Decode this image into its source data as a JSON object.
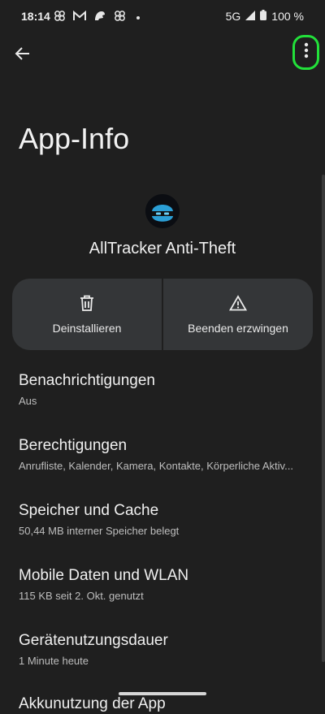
{
  "status": {
    "time": "18:14",
    "network": "5G",
    "battery": "100 %",
    "left_icons": [
      "pinwheel-icon",
      "gmail-icon",
      "dino-icon",
      "pinwheel-icon"
    ]
  },
  "page": {
    "title": "App-Info"
  },
  "app": {
    "name": "AllTracker Anti-Theft",
    "icon": "ninja-mask-icon"
  },
  "actions": [
    {
      "label": "Deinstallieren",
      "icon": "trash-icon"
    },
    {
      "label": "Beenden erzwingen",
      "icon": "warning-icon"
    }
  ],
  "settings": [
    {
      "title": "Benachrichtigungen",
      "subtitle": "Aus"
    },
    {
      "title": "Berechtigungen",
      "subtitle": "Anrufliste, Kalender, Kamera, Kontakte, Körperliche Aktiv..."
    },
    {
      "title": "Speicher und Cache",
      "subtitle": "50,44 MB interner Speicher belegt"
    },
    {
      "title": "Mobile Daten und WLAN",
      "subtitle": "115 KB seit 2. Okt. genutzt"
    },
    {
      "title": "Gerätenutzungsdauer",
      "subtitle": "1 Minute heute"
    },
    {
      "title": "Akkunutzung der App",
      "subtitle": ""
    }
  ],
  "colors": {
    "background": "#1f1f1f",
    "card": "#343638",
    "highlight": "#22e13a"
  }
}
